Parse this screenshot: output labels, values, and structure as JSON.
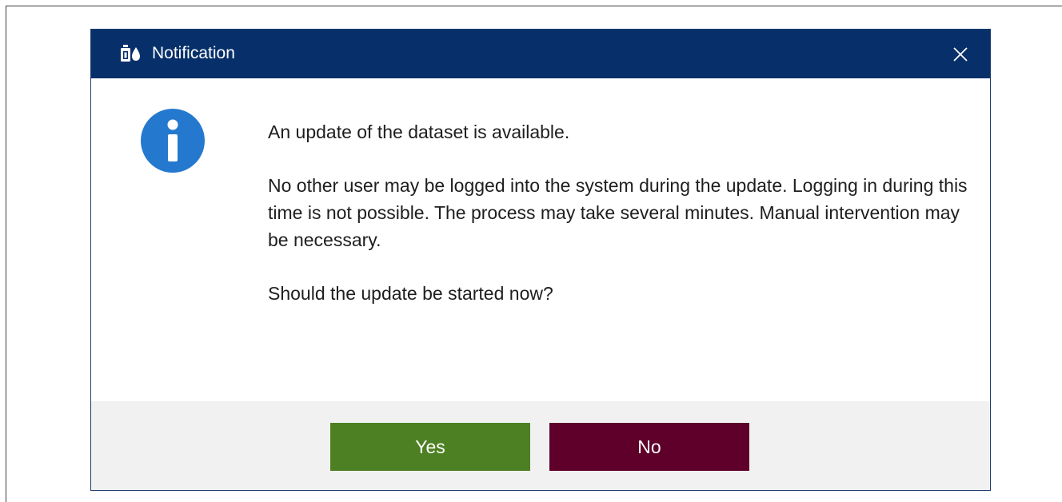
{
  "dialog": {
    "title": "Notification",
    "app_icon": "bottle-drop-icon",
    "close_icon": "close-icon",
    "message_icon": "info-icon",
    "message": {
      "line1": "An update of the dataset is available.",
      "line2": "No other user may be logged into the system during the update. Logging in during this time is not possible. The process may take several minutes. Manual intervention may be necessary.",
      "line3": "Should the update be started now?"
    },
    "buttons": {
      "yes_label": "Yes",
      "no_label": "No"
    }
  },
  "colors": {
    "titlebar": "#07306a",
    "info_icon": "#2479cf",
    "yes_button": "#4c8022",
    "no_button": "#5e0029",
    "footer": "#f1f1f1"
  }
}
